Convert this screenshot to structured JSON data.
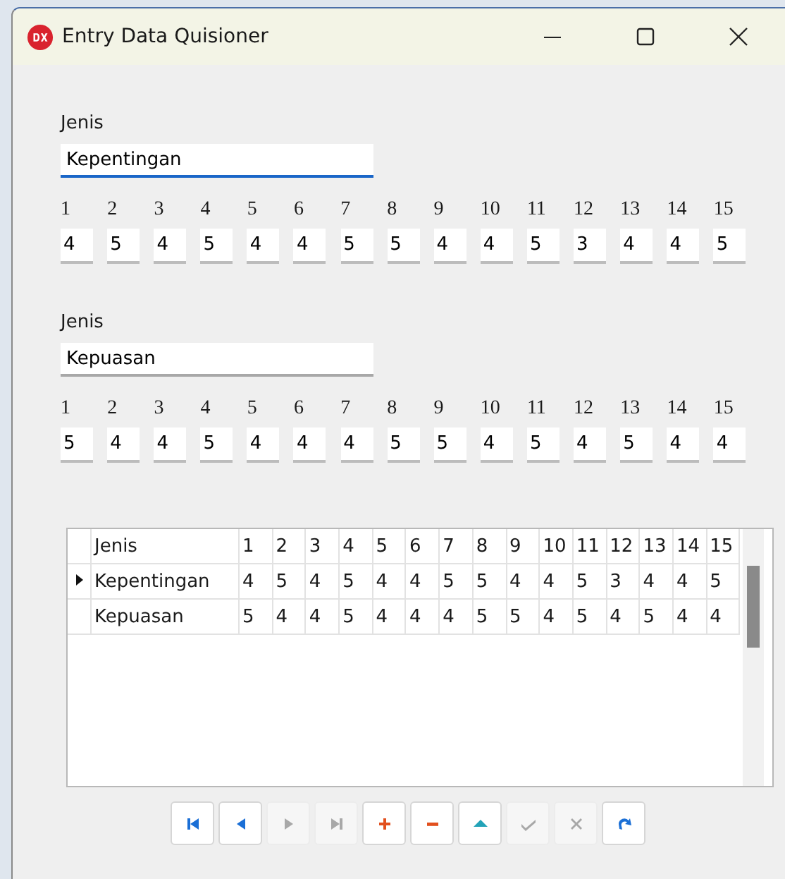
{
  "window": {
    "title": "Entry Data Quisioner"
  },
  "forms": [
    {
      "label": "Jenis",
      "value": "Kepentingan",
      "focused": true,
      "numbers": [
        "1",
        "2",
        "3",
        "4",
        "5",
        "6",
        "7",
        "8",
        "9",
        "10",
        "11",
        "12",
        "13",
        "14",
        "15"
      ],
      "answers": [
        "4",
        "5",
        "4",
        "5",
        "4",
        "4",
        "5",
        "5",
        "4",
        "4",
        "5",
        "3",
        "4",
        "4",
        "5"
      ]
    },
    {
      "label": "Jenis",
      "value": "Kepuasan",
      "focused": false,
      "numbers": [
        "1",
        "2",
        "3",
        "4",
        "5",
        "6",
        "7",
        "8",
        "9",
        "10",
        "11",
        "12",
        "13",
        "14",
        "15"
      ],
      "answers": [
        "5",
        "4",
        "4",
        "5",
        "4",
        "4",
        "4",
        "5",
        "5",
        "4",
        "5",
        "4",
        "5",
        "4",
        "4"
      ]
    }
  ],
  "grid": {
    "columns": [
      "Jenis",
      "1",
      "2",
      "3",
      "4",
      "5",
      "6",
      "7",
      "8",
      "9",
      "10",
      "11",
      "12",
      "13",
      "14",
      "15"
    ],
    "rows": [
      {
        "selected": true,
        "cells": [
          "Kepentingan",
          "4",
          "5",
          "4",
          "5",
          "4",
          "4",
          "5",
          "5",
          "4",
          "4",
          "5",
          "3",
          "4",
          "4",
          "5"
        ]
      },
      {
        "selected": false,
        "cells": [
          "Kepuasan",
          "5",
          "4",
          "4",
          "5",
          "4",
          "4",
          "4",
          "5",
          "5",
          "4",
          "5",
          "4",
          "5",
          "4",
          "4"
        ]
      }
    ]
  },
  "navigator": [
    {
      "kind": "first",
      "disabled": false
    },
    {
      "kind": "prior",
      "disabled": false
    },
    {
      "kind": "next",
      "disabled": true
    },
    {
      "kind": "last",
      "disabled": true
    },
    {
      "kind": "insert",
      "disabled": false
    },
    {
      "kind": "delete",
      "disabled": false
    },
    {
      "kind": "edit",
      "disabled": false
    },
    {
      "kind": "post",
      "disabled": true
    },
    {
      "kind": "cancel",
      "disabled": true
    },
    {
      "kind": "refresh",
      "disabled": false
    }
  ]
}
